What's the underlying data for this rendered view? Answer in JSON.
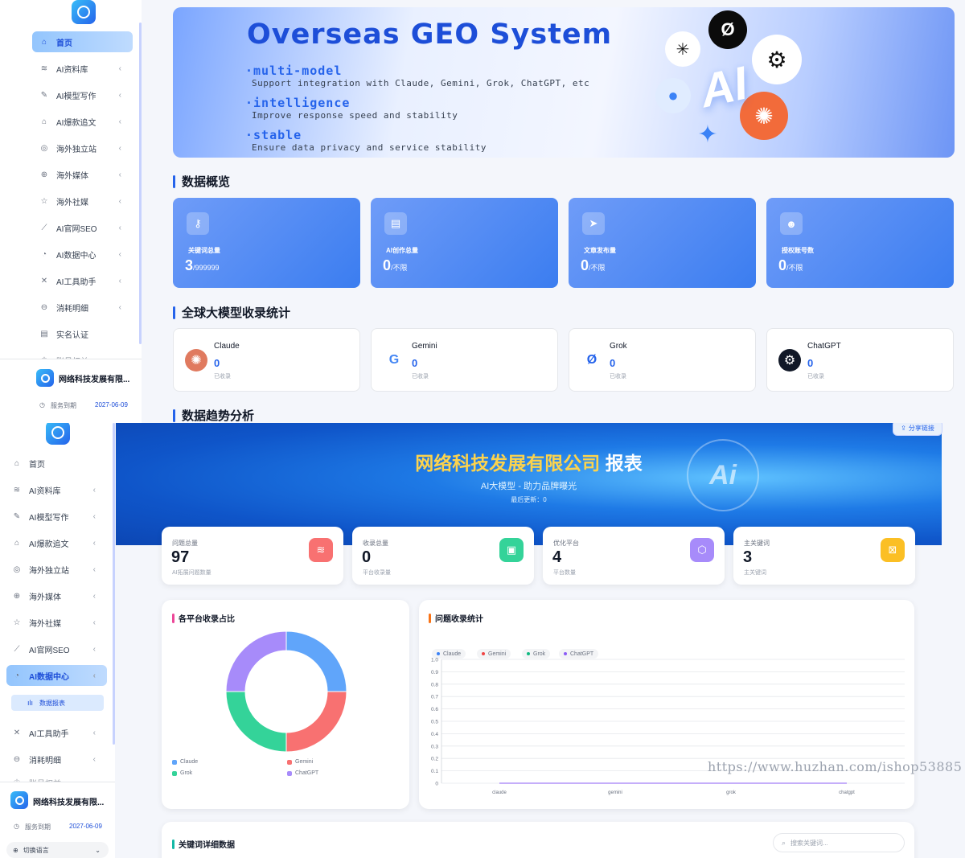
{
  "sidebar": {
    "items": [
      {
        "icon": "home-icon",
        "label": "首页"
      },
      {
        "icon": "layers-icon",
        "label": "AI资料库",
        "chevron": "‹"
      },
      {
        "icon": "pen-icon",
        "label": "AI模型写作",
        "chevron": "‹"
      },
      {
        "icon": "lock-icon",
        "label": "AI爆款追文",
        "chevron": "‹"
      },
      {
        "icon": "globe-icon",
        "label": "海外独立站",
        "chevron": "‹"
      },
      {
        "icon": "web-icon",
        "label": "海外媒体",
        "chevron": "‹"
      },
      {
        "icon": "star-icon",
        "label": "海外社媒",
        "chevron": "‹"
      },
      {
        "icon": "chart-line-icon",
        "label": "AI官网SEO",
        "chevron": "‹"
      },
      {
        "icon": "pie-icon",
        "label": "AI数据中心",
        "chevron": "‹"
      },
      {
        "icon": "tools-icon",
        "label": "AI工具助手",
        "chevron": "‹"
      },
      {
        "icon": "coin-icon",
        "label": "消耗明细",
        "chevron": "‹"
      },
      {
        "icon": "id-card-icon",
        "label": "实名认证"
      },
      {
        "icon": "crown-icon",
        "label": "账号权益"
      }
    ],
    "sub_item": "数据报表",
    "company": "网络科技发展有限...",
    "service_label": "服务到期",
    "service_date": "2027-06-09",
    "language": "切换语言",
    "language_chevron": "⌄"
  },
  "banner": {
    "title": "Overseas GEO System",
    "features": [
      {
        "h": "·multi-model",
        "d": "Support integration with Claude, Gemini, Grok, ChatGPT, etc"
      },
      {
        "h": "·intelligence",
        "d": "Improve response speed and stability"
      },
      {
        "h": "·stable",
        "d": "Ensure data privacy and service stability"
      }
    ],
    "ai": "AI"
  },
  "overview": {
    "title": "数据概览",
    "cards": [
      {
        "icon": "key-icon",
        "label": "关键词总量",
        "value": "3",
        "limit": "/999999"
      },
      {
        "icon": "document-icon",
        "label": "AI创作总量",
        "value": "0",
        "limit": "/不限"
      },
      {
        "icon": "send-icon",
        "label": "文章发布量",
        "value": "0",
        "limit": "/不限"
      },
      {
        "icon": "users-icon",
        "label": "授权账号数",
        "value": "0",
        "limit": "/不限"
      }
    ]
  },
  "models": {
    "title": "全球大模型收录统计",
    "cards": [
      {
        "name": "Claude",
        "value": "0",
        "status": "已收录",
        "color": "#e07a5f",
        "glyph": "✺"
      },
      {
        "name": "Gemini",
        "value": "0",
        "status": "已收录",
        "color": "#4285f4",
        "glyph": "G"
      },
      {
        "name": "Grok",
        "value": "0",
        "status": "已收录",
        "color": "#2563eb",
        "glyph": "Ø"
      },
      {
        "name": "ChatGPT",
        "value": "0",
        "status": "已收录",
        "color": "#111827",
        "glyph": "⚙"
      }
    ]
  },
  "trend_title": "数据趋势分析",
  "report": {
    "title_main": "网络科技发展有限公司",
    "title_suffix": "报表",
    "subtitle": "AI大模型 - 助力品牌曝光",
    "updated": "最后更新：0",
    "share": "分享链接",
    "badge": "Ai"
  },
  "kpis": [
    {
      "label": "问题总量",
      "value": "97",
      "note": "AI拓展问题数量",
      "color": "#f87171",
      "icon": "stack-icon"
    },
    {
      "label": "收录总量",
      "value": "0",
      "note": "平台收录量",
      "color": "#34d399",
      "icon": "briefcase-icon"
    },
    {
      "label": "优化平台",
      "value": "4",
      "note": "平台数量",
      "color": "#a78bfa",
      "icon": "cube-icon"
    },
    {
      "label": "主关键词",
      "value": "3",
      "note": "主关键词",
      "color": "#fbbf24",
      "icon": "tag-icon"
    }
  ],
  "donut": {
    "title": "各平台收录占比",
    "legend": [
      {
        "name": "Claude",
        "color": "#60a5fa"
      },
      {
        "name": "Gemini",
        "color": "#f87171"
      },
      {
        "name": "Grok",
        "color": "#34d399"
      },
      {
        "name": "ChatGPT",
        "color": "#a78bfa"
      }
    ]
  },
  "chart_data": {
    "type": "line",
    "title": "问题收录统计",
    "categories": [
      "claude",
      "gemini",
      "grok",
      "chatgpt"
    ],
    "series": [
      {
        "name": "Claude",
        "color": "#3b82f6",
        "values": [
          0,
          0,
          0,
          0
        ]
      },
      {
        "name": "Gemini",
        "color": "#ef4444",
        "values": [
          0,
          0,
          0,
          0
        ]
      },
      {
        "name": "Grok",
        "color": "#10b981",
        "values": [
          0,
          0,
          0,
          0
        ]
      },
      {
        "name": "ChatGPT",
        "color": "#8b5cf6",
        "values": [
          0,
          0,
          0,
          0
        ]
      }
    ],
    "ylim": [
      0,
      1.0
    ],
    "yticks": [
      "1.0",
      "0.9",
      "0.8",
      "0.7",
      "0.6",
      "0.5",
      "0.4",
      "0.3",
      "0.2",
      "0.1",
      "0"
    ],
    "grid": true
  },
  "keywords": {
    "title": "关键词详细数据",
    "search_placeholder": "搜索关键词..."
  },
  "watermark": "https://www.huzhan.com/ishop53885"
}
